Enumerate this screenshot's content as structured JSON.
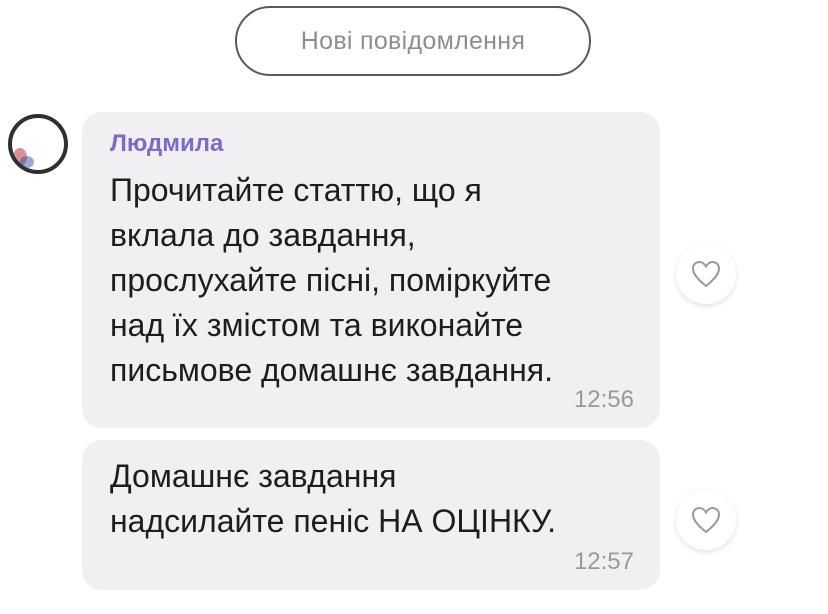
{
  "divider": {
    "label": "Нові повідомлення"
  },
  "messages": [
    {
      "sender": "Людмила",
      "text": "Прочитайте статтю, що я\nвклала до завдання,\nпрослухайте пісні, поміркуйте\nнад їх змістом та виконайте\nписьмове домашнє завдання.",
      "time": "12:56"
    },
    {
      "text": "Домашнє завдання\nнадсилайте пеніс НА ОЦІНКУ.",
      "time": "12:57"
    }
  ],
  "icons": {
    "like": "heart-outline-icon",
    "avatar": "user-avatar"
  },
  "colors": {
    "sender_name": "#7d6bc7",
    "bubble_bg": "#f0f0f2",
    "timestamp": "#999999",
    "divider_text": "#8e8e8e"
  }
}
